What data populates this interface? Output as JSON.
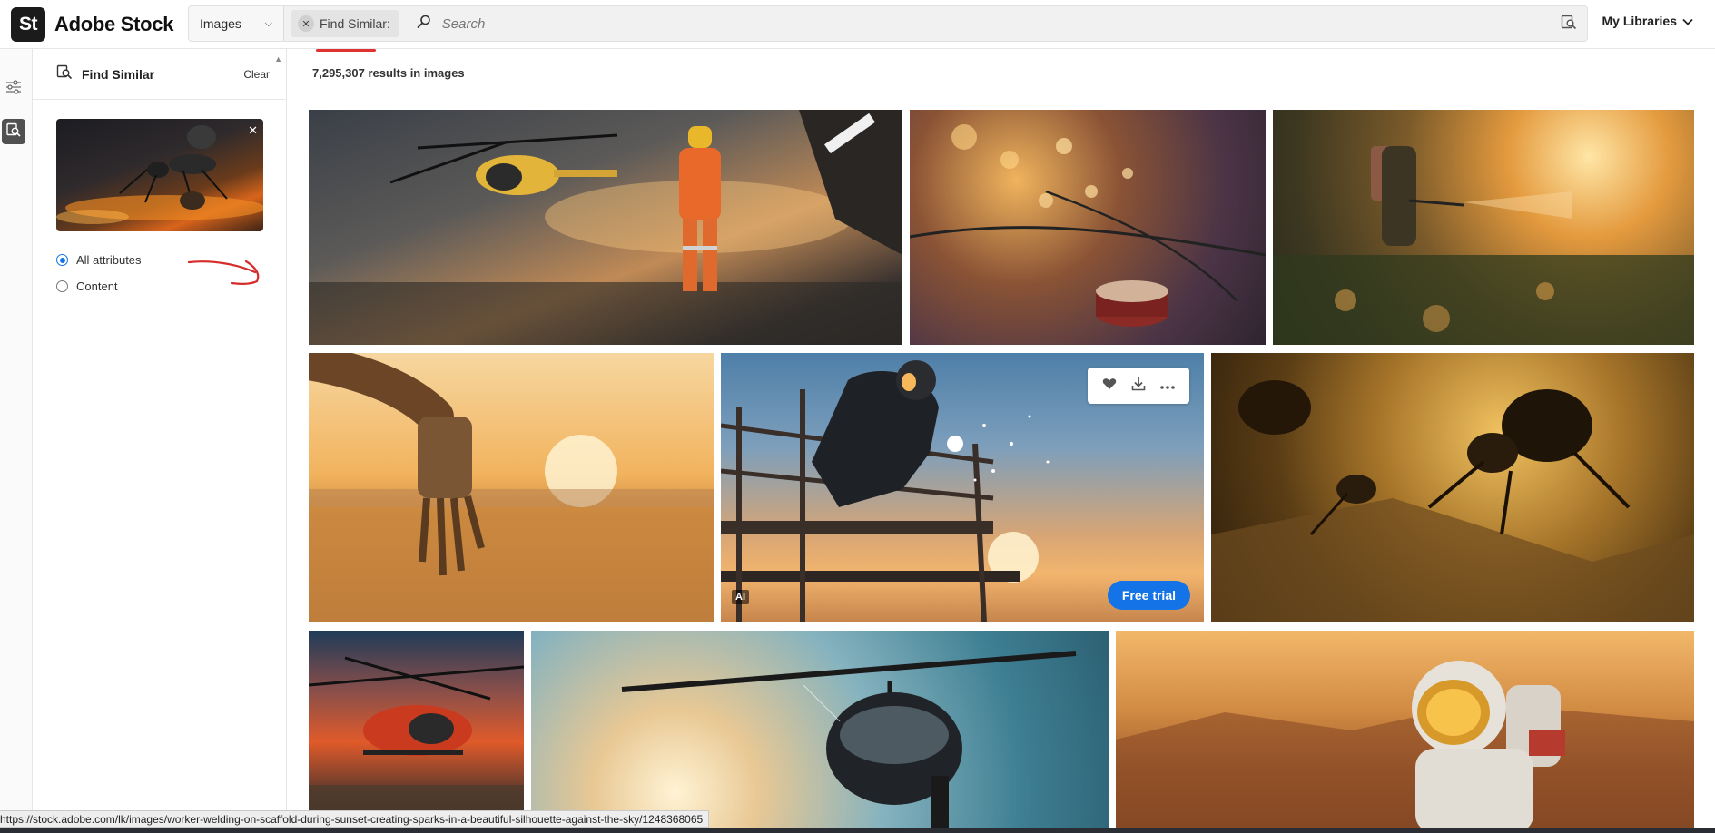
{
  "brand": {
    "badge": "St",
    "name": "Adobe Stock"
  },
  "search": {
    "type_label": "Images",
    "chip_label": "Find Similar:",
    "placeholder": "Search",
    "value": ""
  },
  "header": {
    "my_libraries": "My Libraries"
  },
  "panel": {
    "title": "Find Similar",
    "clear_label": "Clear",
    "options": [
      {
        "label": "All attributes",
        "checked": true
      },
      {
        "label": "Content",
        "checked": false
      }
    ]
  },
  "results": {
    "count_text": "7,295,307 results in images",
    "images": [
      {
        "subject": "worker walking near helicopter at sunset"
      },
      {
        "subject": "string lights on a drum"
      },
      {
        "subject": "person spraying in a field at sunset"
      },
      {
        "subject": "robot hand over desert at sunset"
      },
      {
        "subject": "worker welding on scaffold at sunset",
        "badge": "AI",
        "cta": "Free trial"
      },
      {
        "subject": "ants close-up in golden light"
      },
      {
        "subject": "red helicopter against fiery sky"
      },
      {
        "subject": "helicopter in front of sun"
      },
      {
        "subject": "astronaut in desert landscape"
      }
    ]
  },
  "status_url": "https://stock.adobe.com/lk/images/worker-welding-on-scaffold-during-sunset-creating-sparks-in-a-beautiful-silhouette-against-the-sky/1248368065",
  "colors": {
    "accent": "#1473e6",
    "chip_underline": "#e03131",
    "brand_badge": "#1b1b1b"
  }
}
